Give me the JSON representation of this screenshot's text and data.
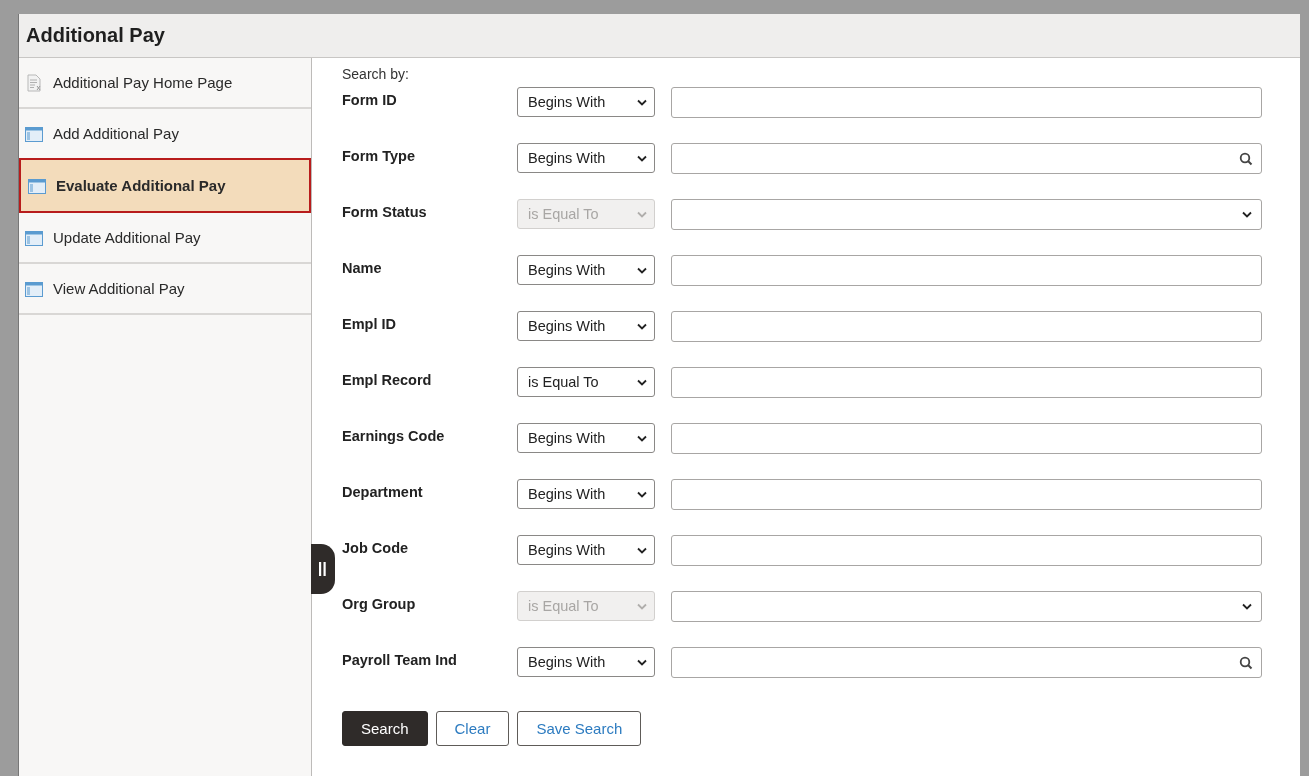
{
  "window": {
    "title": "Additional Pay"
  },
  "sidebar": {
    "items": [
      {
        "label": "Additional Pay Home Page",
        "kind": "document",
        "selected": false
      },
      {
        "label": "Add Additional Pay",
        "kind": "window",
        "selected": false
      },
      {
        "label": "Evaluate Additional Pay",
        "kind": "window",
        "selected": true
      },
      {
        "label": "Update Additional Pay",
        "kind": "window",
        "selected": false
      },
      {
        "label": "View Additional Pay",
        "kind": "window",
        "selected": false
      }
    ]
  },
  "search": {
    "heading": "Search by:",
    "fields": [
      {
        "label": "Form ID",
        "operator": "Begins With",
        "operator_disabled": false,
        "kind": "text"
      },
      {
        "label": "Form Type",
        "operator": "Begins With",
        "operator_disabled": false,
        "kind": "lookup"
      },
      {
        "label": "Form Status",
        "operator": "is Equal To",
        "operator_disabled": true,
        "kind": "dropdown"
      },
      {
        "label": "Name",
        "operator": "Begins With",
        "operator_disabled": false,
        "kind": "text"
      },
      {
        "label": "Empl ID",
        "operator": "Begins With",
        "operator_disabled": false,
        "kind": "text"
      },
      {
        "label": "Empl Record",
        "operator": "is Equal To",
        "operator_disabled": false,
        "kind": "text"
      },
      {
        "label": "Earnings Code",
        "operator": "Begins With",
        "operator_disabled": false,
        "kind": "text"
      },
      {
        "label": "Department",
        "operator": "Begins With",
        "operator_disabled": false,
        "kind": "text"
      },
      {
        "label": "Job Code",
        "operator": "Begins With",
        "operator_disabled": false,
        "kind": "text"
      },
      {
        "label": "Org Group",
        "operator": "is Equal To",
        "operator_disabled": true,
        "kind": "dropdown"
      },
      {
        "label": "Payroll Team Ind",
        "operator": "Begins With",
        "operator_disabled": false,
        "kind": "lookup"
      }
    ],
    "buttons": [
      {
        "label": "Search",
        "kind": "primary"
      },
      {
        "label": "Clear",
        "kind": "secondary"
      },
      {
        "label": "Save Search",
        "kind": "secondary"
      }
    ]
  }
}
